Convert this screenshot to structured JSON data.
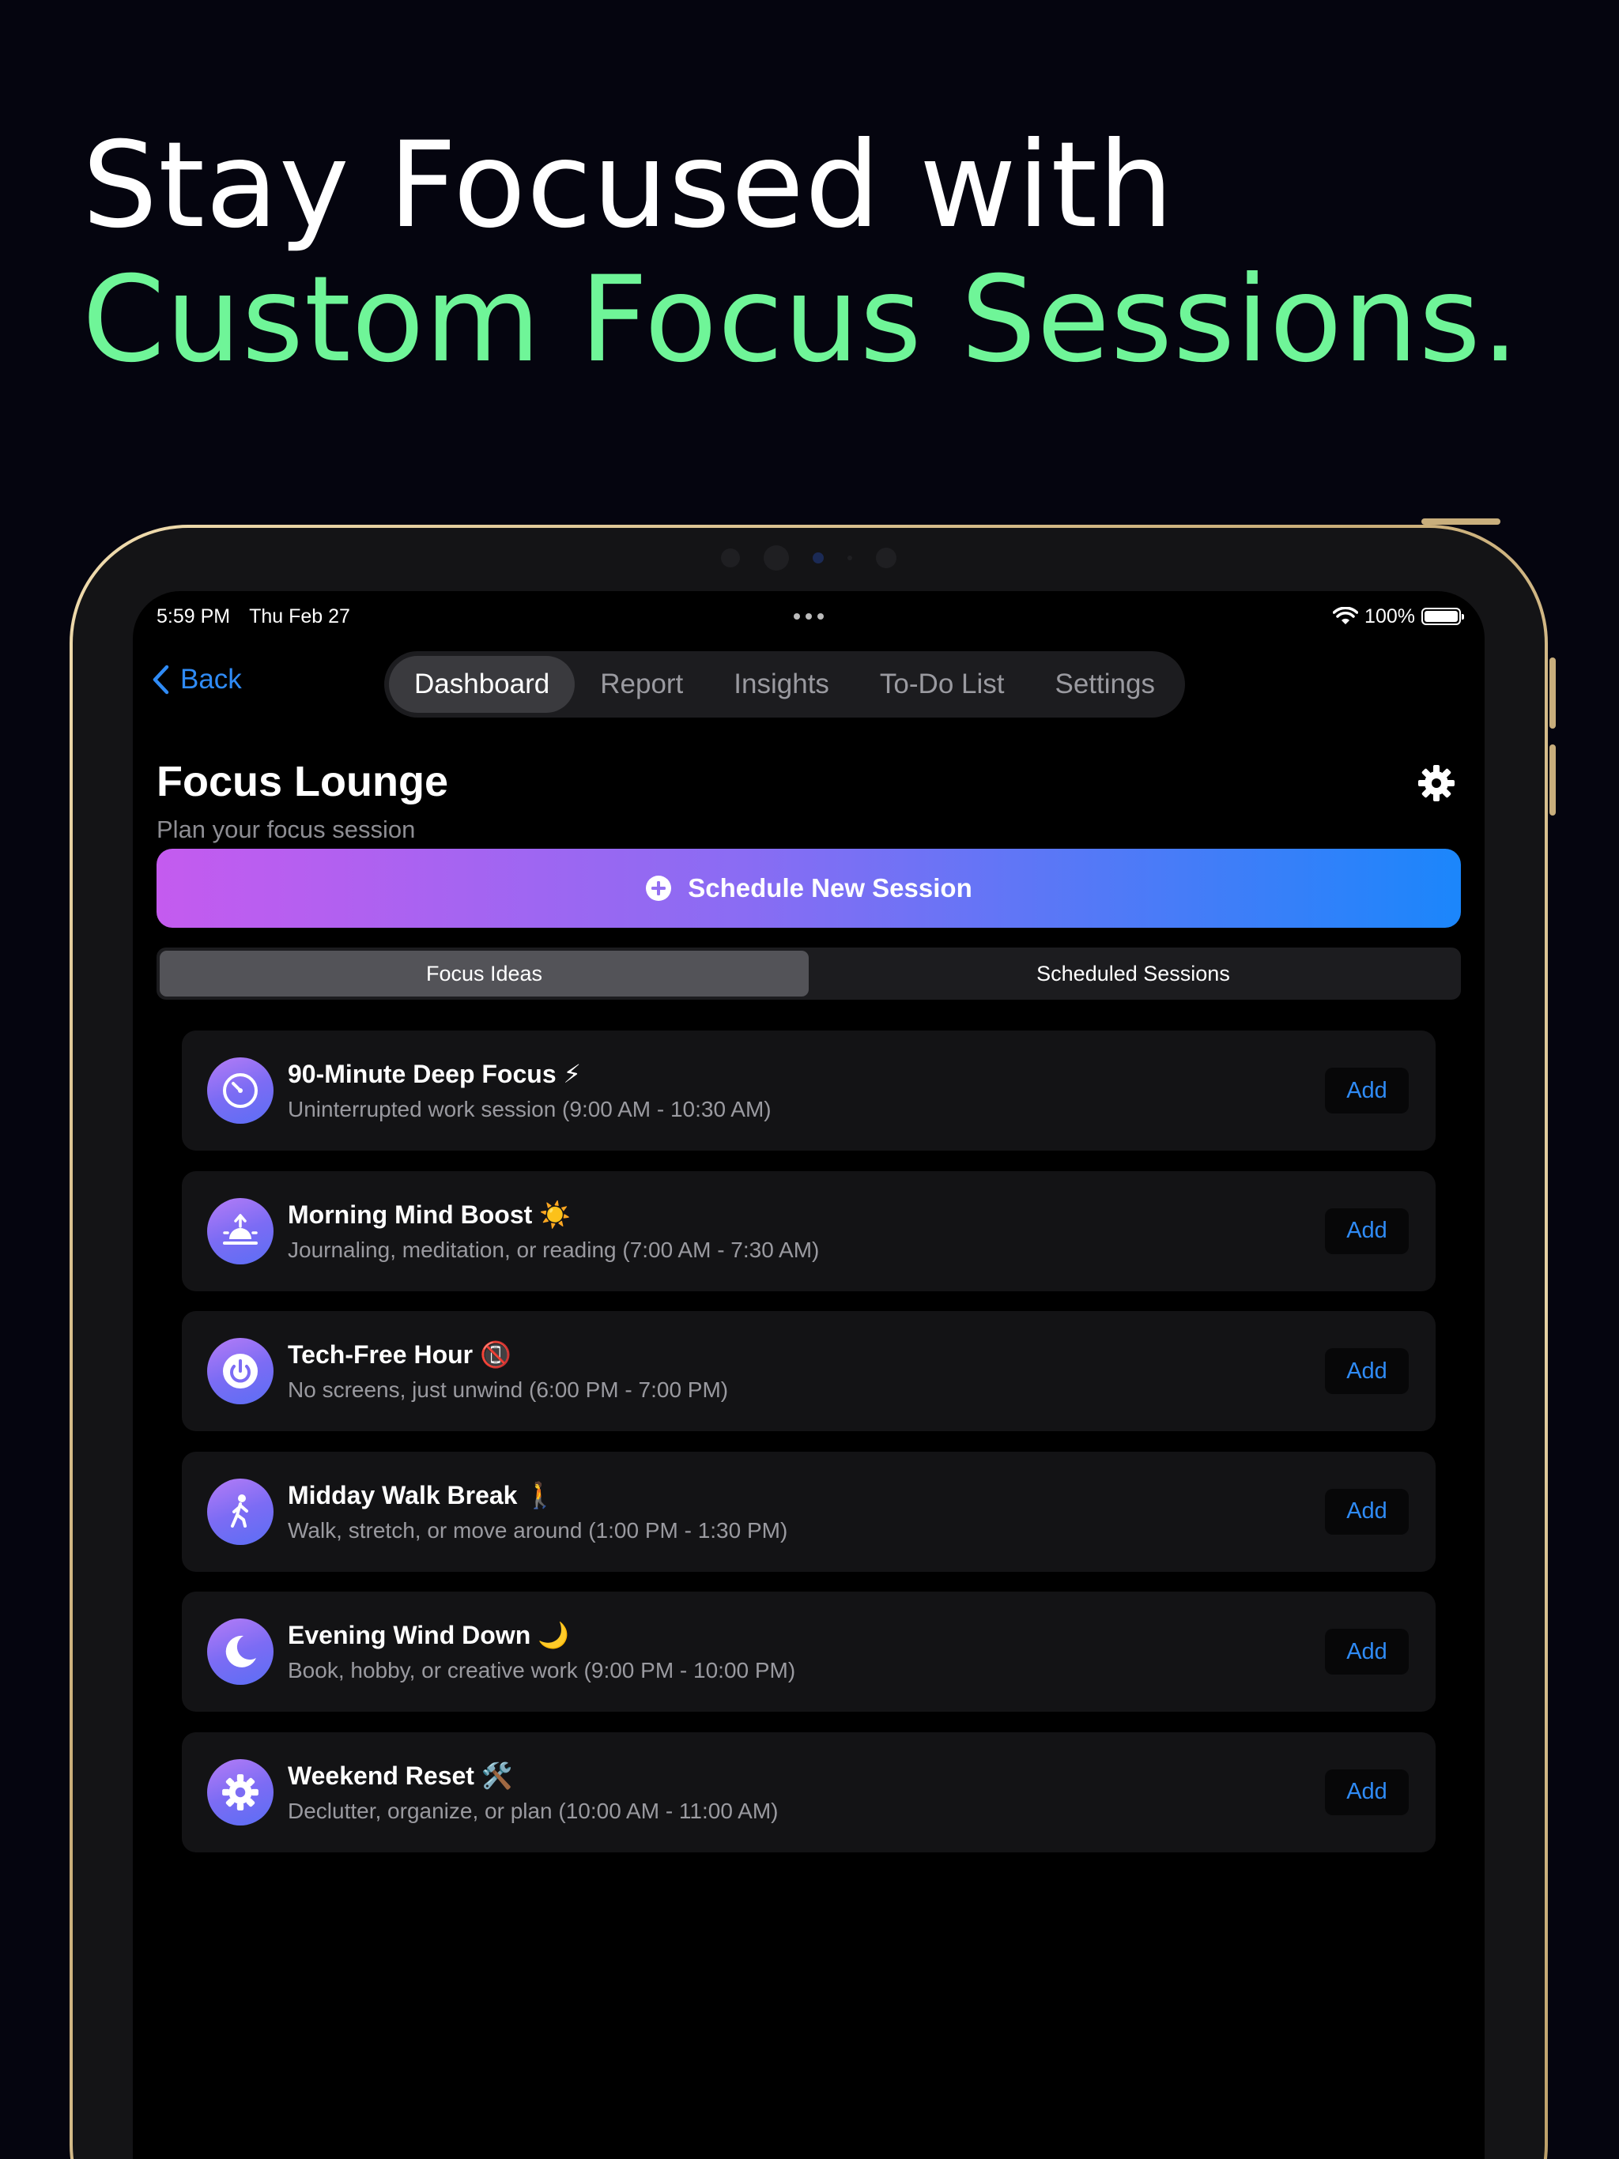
{
  "headline": {
    "line1": "Stay Focused with",
    "line2": "Custom Focus Sessions."
  },
  "status_bar": {
    "time": "5:59 PM",
    "date": "Thu Feb 27",
    "battery": "100%"
  },
  "nav": {
    "back_label": "Back",
    "tabs": [
      {
        "label": "Dashboard",
        "active": true
      },
      {
        "label": "Report",
        "active": false
      },
      {
        "label": "Insights",
        "active": false
      },
      {
        "label": "To-Do List",
        "active": false
      },
      {
        "label": "Settings",
        "active": false
      }
    ]
  },
  "header": {
    "title": "Focus Lounge",
    "subtitle": "Plan your focus session"
  },
  "cta": {
    "label": "Schedule New Session"
  },
  "segmented": {
    "options": [
      {
        "label": "Focus Ideas",
        "active": true
      },
      {
        "label": "Scheduled Sessions",
        "active": false
      }
    ]
  },
  "ideas": [
    {
      "icon": "timer-icon",
      "title": "90-Minute Deep Focus ⚡",
      "description": "Uninterrupted work session (9:00 AM - 10:30 AM)",
      "action": "Add"
    },
    {
      "icon": "sunrise-icon",
      "title": "Morning Mind Boost ☀️",
      "description": "Journaling, meditation, or reading (7:00 AM - 7:30 AM)",
      "action": "Add"
    },
    {
      "icon": "power-icon",
      "title": "Tech-Free Hour 📵",
      "description": "No screens, just unwind (6:00 PM - 7:00 PM)",
      "action": "Add"
    },
    {
      "icon": "walking-icon",
      "title": "Midday Walk Break 🚶",
      "description": "Walk, stretch, or move around (1:00 PM - 1:30 PM)",
      "action": "Add"
    },
    {
      "icon": "moon-icon",
      "title": "Evening Wind Down 🌙",
      "description": "Book, hobby, or creative work (9:00 PM - 10:00 PM)",
      "action": "Add"
    },
    {
      "icon": "gear-icon",
      "title": "Weekend Reset 🛠️",
      "description": "Declutter, organize, or plan (10:00 AM - 11:00 AM)",
      "action": "Add"
    }
  ],
  "colors": {
    "background": "#05050f",
    "headline_accent": "#6ff598",
    "accent_blue": "#2f8bf6",
    "gradient_start": "#c45bef",
    "gradient_end": "#1b86fb"
  }
}
